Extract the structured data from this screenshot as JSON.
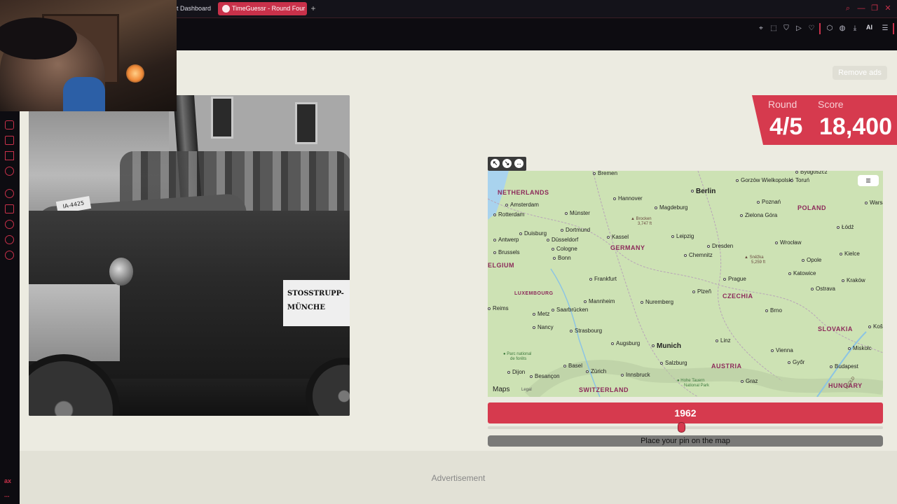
{
  "browser": {
    "tabs": [
      {
        "label": "t Dashboard",
        "active": false
      },
      {
        "label": "TimeGuessr - Round Four",
        "active": true
      }
    ],
    "new_tab_label": "+",
    "toolbar_ai_label": "AI"
  },
  "sidebar": {
    "bottom_label": "ax",
    "more_label": "..."
  },
  "page": {
    "remove_ads_label": "Remove ads",
    "photo": {
      "plate_text": "IA-4425",
      "sign_line1": "STOSSTRUPP-",
      "sign_line2": "MÜNCHE"
    },
    "score": {
      "round_label": "Round",
      "round_value": "4/5",
      "score_label": "Score",
      "score_value": "18,400"
    },
    "map": {
      "controls": [
        "↖",
        "↘",
        "↔"
      ],
      "toggle_icon": "map-icon",
      "logo": " Maps",
      "legal": "Legal",
      "cities": [
        {
          "name": "Bremen",
          "big": false
        },
        {
          "name": "Berlin",
          "big": true
        },
        {
          "name": "Bydgoszcz",
          "big": false
        },
        {
          "name": "Gorzów Wielkopolski",
          "big": false
        },
        {
          "name": "Toruń",
          "big": false
        },
        {
          "name": "Amsterdam",
          "big": false
        },
        {
          "name": "Hannover",
          "big": false
        },
        {
          "name": "Magdeburg",
          "big": false
        },
        {
          "name": "Poznań",
          "big": false
        },
        {
          "name": "Warsa",
          "big": false
        },
        {
          "name": "Rotterdam",
          "big": false
        },
        {
          "name": "Münster",
          "big": false
        },
        {
          "name": "Zielona Góra",
          "big": false
        },
        {
          "name": "Łódź",
          "big": false
        },
        {
          "name": "Duisburg",
          "big": false
        },
        {
          "name": "Dortmund",
          "big": false
        },
        {
          "name": "Antwerp",
          "big": false
        },
        {
          "name": "Düsseldorf",
          "big": false
        },
        {
          "name": "Kassel",
          "big": false
        },
        {
          "name": "Leipzig",
          "big": false
        },
        {
          "name": "Dresden",
          "big": false
        },
        {
          "name": "Wrocław",
          "big": false
        },
        {
          "name": "Cologne",
          "big": false
        },
        {
          "name": "Brussels",
          "big": false
        },
        {
          "name": "Bonn",
          "big": false
        },
        {
          "name": "Chemnitz",
          "big": false
        },
        {
          "name": "Opole",
          "big": false
        },
        {
          "name": "Kielce",
          "big": false
        },
        {
          "name": "Frankfurt",
          "big": false
        },
        {
          "name": "Katowice",
          "big": false
        },
        {
          "name": "Prague",
          "big": false
        },
        {
          "name": "Kraków",
          "big": false
        },
        {
          "name": "Plzeň",
          "big": false
        },
        {
          "name": "Ostrava",
          "big": false
        },
        {
          "name": "Mannheim",
          "big": false
        },
        {
          "name": "Nuremberg",
          "big": false
        },
        {
          "name": "Reims",
          "big": false
        },
        {
          "name": "Saarbrücken",
          "big": false
        },
        {
          "name": "Metz",
          "big": false
        },
        {
          "name": "Brno",
          "big": false
        },
        {
          "name": "Nancy",
          "big": false
        },
        {
          "name": "Strasbourg",
          "big": false
        },
        {
          "name": "Košic",
          "big": false
        },
        {
          "name": "Augsburg",
          "big": false
        },
        {
          "name": "Munich",
          "big": true
        },
        {
          "name": "Linz",
          "big": false
        },
        {
          "name": "Vienna",
          "big": false
        },
        {
          "name": "Miskolc",
          "big": false
        },
        {
          "name": "Basel",
          "big": false
        },
        {
          "name": "Zürich",
          "big": false
        },
        {
          "name": "Salzburg",
          "big": false
        },
        {
          "name": "Győr",
          "big": false
        },
        {
          "name": "Budapest",
          "big": false
        },
        {
          "name": "Dijon",
          "big": false
        },
        {
          "name": "Besançon",
          "big": false
        },
        {
          "name": "Innsbruck",
          "big": false
        },
        {
          "name": "Graz",
          "big": false
        }
      ],
      "countries": [
        "NETHERLANDS",
        "GERMANY",
        "POLAND",
        "ELGIUM",
        "LUXEMBOURG",
        "CZECHIA",
        "SLOVAKIA",
        "AUSTRIA",
        "SWITZERLAND",
        "HUNGARY"
      ],
      "peaks": [
        {
          "name": "Brocken",
          "height": "3,747 ft"
        },
        {
          "name": "Sněžka",
          "height": "5,259 ft"
        }
      ],
      "parks": [
        {
          "line1": "Parc national",
          "line2": "de forêts"
        },
        {
          "line1": "Hohe Tauern",
          "line2": "National Park"
        }
      ],
      "road_label": "LEOLD"
    },
    "year_value": "1962",
    "year_fraction": 0.49,
    "place_pin_label": "Place your pin on the map",
    "ad_label": "Advertisement"
  }
}
